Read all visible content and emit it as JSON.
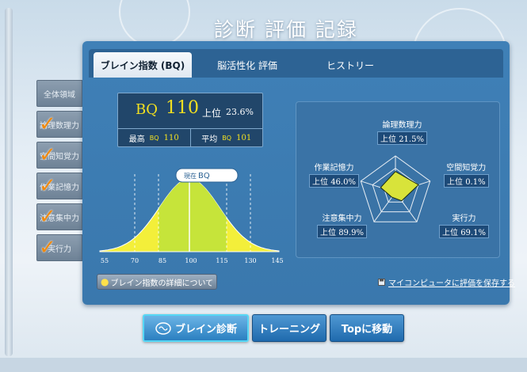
{
  "page_title": "診断 評価 記録",
  "tabs": [
    {
      "label": "ブレイン指数 (BQ)",
      "active": true
    },
    {
      "label": "脳活性化 評価",
      "active": false
    },
    {
      "label": "ヒストリー",
      "active": false
    }
  ],
  "side_tabs": [
    {
      "label": "全体領域",
      "checked": false
    },
    {
      "label": "論理数理力",
      "checked": true
    },
    {
      "label": "空間知覚力",
      "checked": true
    },
    {
      "label": "作業記憶力",
      "checked": true
    },
    {
      "label": "注意集中力",
      "checked": true
    },
    {
      "label": "実行力",
      "checked": true
    }
  ],
  "bq": {
    "label": "BQ",
    "value": "110",
    "rank_label": "上位",
    "rank_pct": "23.6%",
    "max_label": "最高",
    "max_bq": "BQ",
    "max_value": "110",
    "avg_label": "平均",
    "avg_bq": "BQ",
    "avg_value": "101"
  },
  "bell_chart": {
    "marker_label_prefix": "現在",
    "marker_label": "BQ",
    "x_ticks": [
      "55",
      "70",
      "85",
      "100",
      "115",
      "130",
      "145"
    ]
  },
  "chart_data": {
    "type": "radar",
    "axes": [
      "論理数理力",
      "空間知覚力",
      "実行力",
      "注意集中力",
      "作業記憶力"
    ],
    "rank_label": "上位",
    "values_pct": [
      "21.5%",
      "0.1%",
      "69.1%",
      "89.9%",
      "46.0%"
    ],
    "fill_color": "#d8e33a"
  },
  "detail_button": "ブレイン指数の詳細について",
  "save_link": "マイコンピュータに評価を保存する",
  "bottom_buttons": [
    {
      "label": "ブレイン診断",
      "active": true
    },
    {
      "label": "トレーニング",
      "active": false
    },
    {
      "label": "Topに移動",
      "active": false
    }
  ],
  "colors": {
    "accent": "#f08a10",
    "bell_fill": "#c6e43a",
    "bell_tail": "#f3ef3a"
  }
}
